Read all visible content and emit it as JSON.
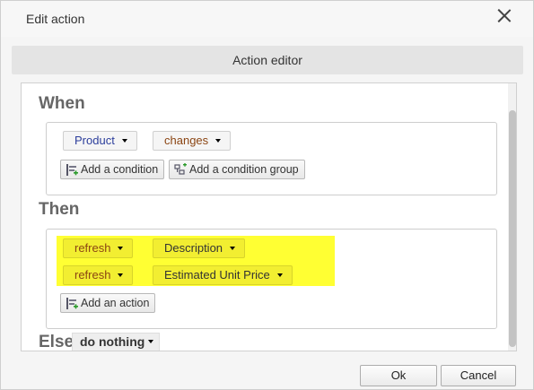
{
  "dialog": {
    "title": "Edit action"
  },
  "editor_header": "Action editor",
  "when": {
    "label": "When",
    "field": "Product",
    "operator": "changes",
    "add_condition": "Add a condition",
    "add_condition_group": "Add a condition group"
  },
  "then": {
    "label": "Then",
    "actions": [
      {
        "verb": "refresh",
        "target": "Description"
      },
      {
        "verb": "refresh",
        "target": "Estimated Unit Price"
      }
    ],
    "add_action": "Add an action",
    "highlight_color": "#ffff33"
  },
  "else": {
    "label": "Else",
    "value": "do nothing"
  },
  "footer": {
    "ok": "Ok",
    "cancel": "Cancel"
  },
  "colors": {
    "field_blue": "#2c3e9c",
    "operator_brown": "#8b4513",
    "heading_gray": "#666666"
  }
}
